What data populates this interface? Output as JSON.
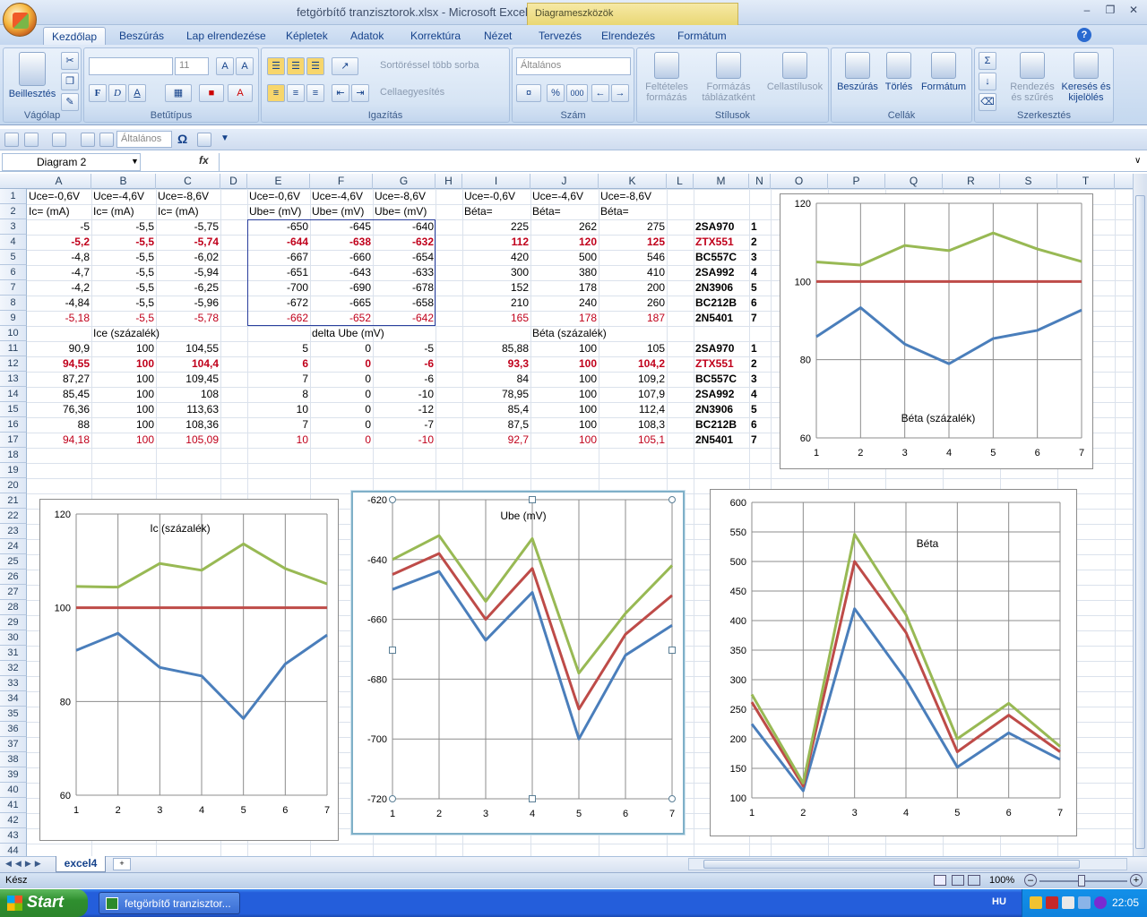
{
  "window": {
    "title": "fetgörbítő tranzisztorok.xlsx - Microsoft Excel",
    "contextual": "Diagrameszközök"
  },
  "tabs": [
    "Kezdőlap",
    "Beszúrás",
    "Lap elrendezése",
    "Képletek",
    "Adatok",
    "Korrektúra",
    "Nézet",
    "Tervezés",
    "Elrendezés",
    "Formátum"
  ],
  "ribbon": {
    "clipboard": {
      "label": "Vágólap",
      "paste": "Beillesztés"
    },
    "font": {
      "label": "Betűtípus",
      "size": "11",
      "bold": "F",
      "italic": "D",
      "underline": "A"
    },
    "alignment": {
      "label": "Igazítás",
      "wrap": "Sortöréssel több sorba",
      "merge": "Cellaegyesítés"
    },
    "number": {
      "label": "Szám",
      "format": "Általános",
      "percent": "%",
      "thousands": "000"
    },
    "styles": {
      "label": "Stílusok",
      "conditional1": "Feltételes",
      "conditional2": "formázás",
      "table1": "Formázás",
      "table2": "táblázatként",
      "cell": "Cellastílusok"
    },
    "cells": {
      "label": "Cellák",
      "insert": "Beszúrás",
      "delete": "Törlés",
      "format": "Formátum"
    },
    "editing": {
      "label": "Szerkesztés",
      "sort1": "Rendezés",
      "sort2": "és szűrés",
      "find1": "Keresés és",
      "find2": "kijelölés"
    }
  },
  "qat": {
    "style_box": "Általános",
    "omega": "Ω"
  },
  "formula": {
    "namebox": "Diagram 2",
    "fx": "fx"
  },
  "columns": [
    "A",
    "B",
    "C",
    "D",
    "E",
    "F",
    "G",
    "H",
    "I",
    "J",
    "K",
    "L",
    "M",
    "N",
    "O",
    "P",
    "Q",
    "R",
    "S",
    "T"
  ],
  "rows": [
    "1",
    "2",
    "3",
    "4",
    "5",
    "6",
    "7",
    "8",
    "9",
    "10",
    "11",
    "12",
    "13",
    "14",
    "15",
    "16",
    "17",
    "18",
    "19",
    "20",
    "21",
    "22",
    "23",
    "24",
    "25",
    "26",
    "27",
    "28",
    "29",
    "30",
    "31",
    "32",
    "33",
    "34",
    "35",
    "36",
    "37",
    "38",
    "39",
    "40",
    "41",
    "42",
    "43",
    "44"
  ],
  "sheet": {
    "header1": [
      "Uce=-0,6V",
      "Uce=-4,6V",
      "Uce=-8,6V",
      "Uce=-0,6V",
      "Uce=-4,6V",
      "Uce=-8,6V",
      "Uce=-0,6V",
      "Uce=-4,6V",
      "Uce=-8,6V"
    ],
    "header2": [
      "Ic= (mA)",
      "Ic= (mA)",
      "Ic= (mA)",
      "Ube= (mV)",
      "Ube= (mV)",
      "Ube= (mV)",
      "Béta=",
      "Béta=",
      "Béta="
    ],
    "top_rows": [
      [
        "-5",
        "-5,5",
        "-5,75",
        "-650",
        "-645",
        "-640",
        "225",
        "262",
        "275",
        "2SA970",
        "1"
      ],
      [
        "-5,2",
        "-5,5",
        "-5,74",
        "-644",
        "-638",
        "-632",
        "112",
        "120",
        "125",
        "ZTX551",
        "2"
      ],
      [
        "-4,8",
        "-5,5",
        "-6,02",
        "-667",
        "-660",
        "-654",
        "420",
        "500",
        "546",
        "BC557C",
        "3"
      ],
      [
        "-4,7",
        "-5,5",
        "-5,94",
        "-651",
        "-643",
        "-633",
        "300",
        "380",
        "410",
        "2SA992",
        "4"
      ],
      [
        "-4,2",
        "-5,5",
        "-6,25",
        "-700",
        "-690",
        "-678",
        "152",
        "178",
        "200",
        "2N3906",
        "5"
      ],
      [
        "-4,84",
        "-5,5",
        "-5,96",
        "-672",
        "-665",
        "-658",
        "210",
        "240",
        "260",
        "BC212B",
        "6"
      ],
      [
        "-5,18",
        "-5,5",
        "-5,78",
        "-662",
        "-652",
        "-642",
        "165",
        "178",
        "187",
        "2N5401",
        "7"
      ]
    ],
    "row10": {
      "ic": "Ice (százalék)",
      "ube": "delta Ube (mV)",
      "beta": "Béta (százalék)"
    },
    "bottom_rows": [
      [
        "90,9",
        "100",
        "104,55",
        "5",
        "0",
        "-5",
        "85,88",
        "100",
        "105",
        "2SA970",
        "1"
      ],
      [
        "94,55",
        "100",
        "104,4",
        "6",
        "0",
        "-6",
        "93,3",
        "100",
        "104,2",
        "ZTX551",
        "2"
      ],
      [
        "87,27",
        "100",
        "109,45",
        "7",
        "0",
        "-6",
        "84",
        "100",
        "109,2",
        "BC557C",
        "3"
      ],
      [
        "85,45",
        "100",
        "108",
        "8",
        "0",
        "-10",
        "78,95",
        "100",
        "107,9",
        "2SA992",
        "4"
      ],
      [
        "76,36",
        "100",
        "113,63",
        "10",
        "0",
        "-12",
        "85,4",
        "100",
        "112,4",
        "2N3906",
        "5"
      ],
      [
        "88",
        "100",
        "108,36",
        "7",
        "0",
        "-7",
        "87,5",
        "100",
        "108,3",
        "BC212B",
        "6"
      ],
      [
        "94,18",
        "100",
        "105,09",
        "10",
        "0",
        "-10",
        "92,7",
        "100",
        "105,1",
        "2N5401",
        "7"
      ]
    ]
  },
  "chart_data": [
    {
      "type": "line",
      "title": "Béta  (százalék)",
      "x": [
        1,
        2,
        3,
        4,
        5,
        6,
        7
      ],
      "ylim": [
        60,
        120
      ],
      "yticks": [
        60,
        80,
        100,
        120
      ],
      "series": [
        {
          "values": [
            85.88,
            93.3,
            84,
            78.95,
            85.4,
            87.5,
            92.7
          ],
          "color": "#4a7ebb"
        },
        {
          "values": [
            100,
            100,
            100,
            100,
            100,
            100,
            100
          ],
          "color": "#be4b48"
        },
        {
          "values": [
            105,
            104.2,
            109.2,
            107.9,
            112.4,
            108.3,
            105.1
          ],
          "color": "#98b954"
        }
      ]
    },
    {
      "type": "line",
      "title": "Ic  (százalék)",
      "x": [
        1,
        2,
        3,
        4,
        5,
        6,
        7
      ],
      "ylim": [
        60,
        120
      ],
      "yticks": [
        60,
        80,
        100,
        120
      ],
      "series": [
        {
          "values": [
            90.9,
            94.55,
            87.27,
            85.45,
            76.36,
            88,
            94.18
          ],
          "color": "#4a7ebb"
        },
        {
          "values": [
            100,
            100,
            100,
            100,
            100,
            100,
            100
          ],
          "color": "#be4b48"
        },
        {
          "values": [
            104.55,
            104.4,
            109.45,
            108,
            113.63,
            108.36,
            105.09
          ],
          "color": "#98b954"
        }
      ]
    },
    {
      "type": "line",
      "title": "Ube  (mV)",
      "x": [
        1,
        2,
        3,
        4,
        5,
        6,
        7
      ],
      "ylim": [
        -720,
        -620
      ],
      "yticks": [
        -720,
        -700,
        -680,
        -660,
        -640,
        -620
      ],
      "series": [
        {
          "values": [
            -650,
            -644,
            -667,
            -651,
            -700,
            -672,
            -662
          ],
          "color": "#4a7ebb"
        },
        {
          "values": [
            -645,
            -638,
            -660,
            -643,
            -690,
            -665,
            -652
          ],
          "color": "#be4b48"
        },
        {
          "values": [
            -640,
            -632,
            -654,
            -633,
            -678,
            -658,
            -642
          ],
          "color": "#98b954"
        }
      ]
    },
    {
      "type": "line",
      "title": "Béta",
      "x": [
        1,
        2,
        3,
        4,
        5,
        6,
        7
      ],
      "ylim": [
        100,
        600
      ],
      "yticks": [
        100,
        150,
        200,
        250,
        300,
        350,
        400,
        450,
        500,
        550,
        600
      ],
      "series": [
        {
          "values": [
            225,
            112,
            420,
            300,
            152,
            210,
            165
          ],
          "color": "#4a7ebb"
        },
        {
          "values": [
            262,
            120,
            500,
            380,
            178,
            240,
            178
          ],
          "color": "#be4b48"
        },
        {
          "values": [
            275,
            125,
            546,
            410,
            200,
            260,
            187
          ],
          "color": "#98b954"
        }
      ]
    }
  ],
  "sheettabs": {
    "active": "excel4"
  },
  "status": {
    "ready": "Kész",
    "zoom": "100%"
  },
  "taskbar": {
    "start": "Start",
    "item": "fetgörbítő tranzisztor...",
    "lang": "HU",
    "time": "22:05"
  }
}
